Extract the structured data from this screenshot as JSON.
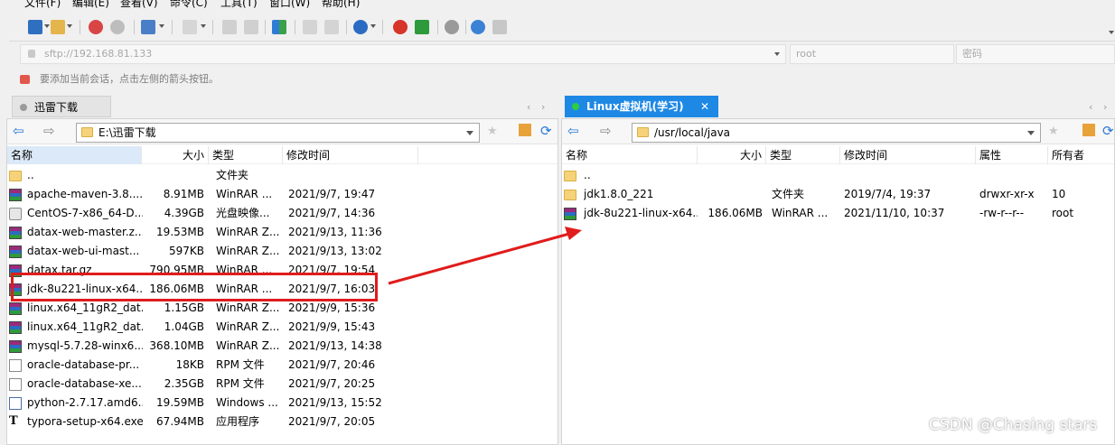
{
  "menu": [
    "文件(F)",
    "编辑(E)",
    "查看(V)",
    "命令(C)",
    "工具(T)",
    "窗口(W)",
    "帮助(H)"
  ],
  "address": {
    "host": "sftp://192.168.81.133",
    "user": "root",
    "password_placeholder": "密码",
    "hint": "要添加当前会话，点击左侧的箭头按钮。"
  },
  "left_pane": {
    "tab_label": "迅雷下载",
    "path": "E:\\迅雷下载",
    "columns": [
      "名称",
      "大小",
      "类型",
      "修改时间"
    ],
    "rows": [
      {
        "name": "..",
        "size": "",
        "type": "文件夹",
        "modified": "",
        "icon": "folder-icon"
      },
      {
        "name": "apache-maven-3.8....",
        "size": "8.91MB",
        "type": "WinRAR ...",
        "modified": "2021/9/7, 19:47",
        "icon": "rar-icon"
      },
      {
        "name": "CentOS-7-x86_64-D...",
        "size": "4.39GB",
        "type": "光盘映像...",
        "modified": "2021/9/7, 14:36",
        "icon": "disc-image-icon"
      },
      {
        "name": "datax-web-master.z...",
        "size": "19.53MB",
        "type": "WinRAR Z...",
        "modified": "2021/9/13, 11:36",
        "icon": "rar-icon"
      },
      {
        "name": "datax-web-ui-mast...",
        "size": "597KB",
        "type": "WinRAR Z...",
        "modified": "2021/9/13, 13:02",
        "icon": "rar-icon"
      },
      {
        "name": "datax.tar.gz",
        "size": "790.95MB",
        "type": "WinRAR ...",
        "modified": "2021/9/7, 19:54",
        "icon": "rar-icon"
      },
      {
        "name": "jdk-8u221-linux-x64...",
        "size": "186.06MB",
        "type": "WinRAR ...",
        "modified": "2021/9/7, 16:03",
        "icon": "rar-icon"
      },
      {
        "name": "linux.x64_11gR2_dat...",
        "size": "1.15GB",
        "type": "WinRAR Z...",
        "modified": "2021/9/9, 15:36",
        "icon": "rar-icon"
      },
      {
        "name": "linux.x64_11gR2_dat...",
        "size": "1.04GB",
        "type": "WinRAR Z...",
        "modified": "2021/9/9, 15:43",
        "icon": "rar-icon"
      },
      {
        "name": "mysql-5.7.28-winx6...",
        "size": "368.10MB",
        "type": "WinRAR Z...",
        "modified": "2021/9/13, 14:38",
        "icon": "rar-icon"
      },
      {
        "name": "oracle-database-pr...",
        "size": "18KB",
        "type": "RPM 文件",
        "modified": "2021/9/7, 20:46",
        "icon": "document-icon"
      },
      {
        "name": "oracle-database-xe...",
        "size": "2.35GB",
        "type": "RPM 文件",
        "modified": "2021/9/7, 20:25",
        "icon": "document-icon"
      },
      {
        "name": "python-2.7.17.amd6...",
        "size": "19.59MB",
        "type": "Windows ...",
        "modified": "2021/9/13, 15:52",
        "icon": "python-installer-icon"
      },
      {
        "name": "typora-setup-x64.exe",
        "size": "67.94MB",
        "type": "应用程序",
        "modified": "2021/9/7, 20:05",
        "icon": "typora-icon"
      }
    ]
  },
  "right_pane": {
    "tab_label": "Linux虚拟机(学习)",
    "path": "/usr/local/java",
    "columns": [
      "名称",
      "大小",
      "类型",
      "修改时间",
      "属性",
      "所有者"
    ],
    "rows": [
      {
        "name": "..",
        "size": "",
        "type": "",
        "modified": "",
        "attrs": "",
        "owner": "",
        "icon": "folder-icon"
      },
      {
        "name": "jdk1.8.0_221",
        "size": "",
        "type": "文件夹",
        "modified": "2019/7/4, 19:37",
        "attrs": "drwxr-xr-x",
        "owner": "10",
        "icon": "folder-icon"
      },
      {
        "name": "jdk-8u221-linux-x64...",
        "size": "186.06MB",
        "type": "WinRAR ...",
        "modified": "2021/11/10, 10:37",
        "attrs": "-rw-r--r--",
        "owner": "root",
        "icon": "rar-icon"
      }
    ]
  },
  "watermark": "CSDN @Chasing stars",
  "colors": {
    "accent_tab": "#1e88e5",
    "annotation_red": "#e01c1c",
    "connected_dot": "#2ecc40"
  }
}
